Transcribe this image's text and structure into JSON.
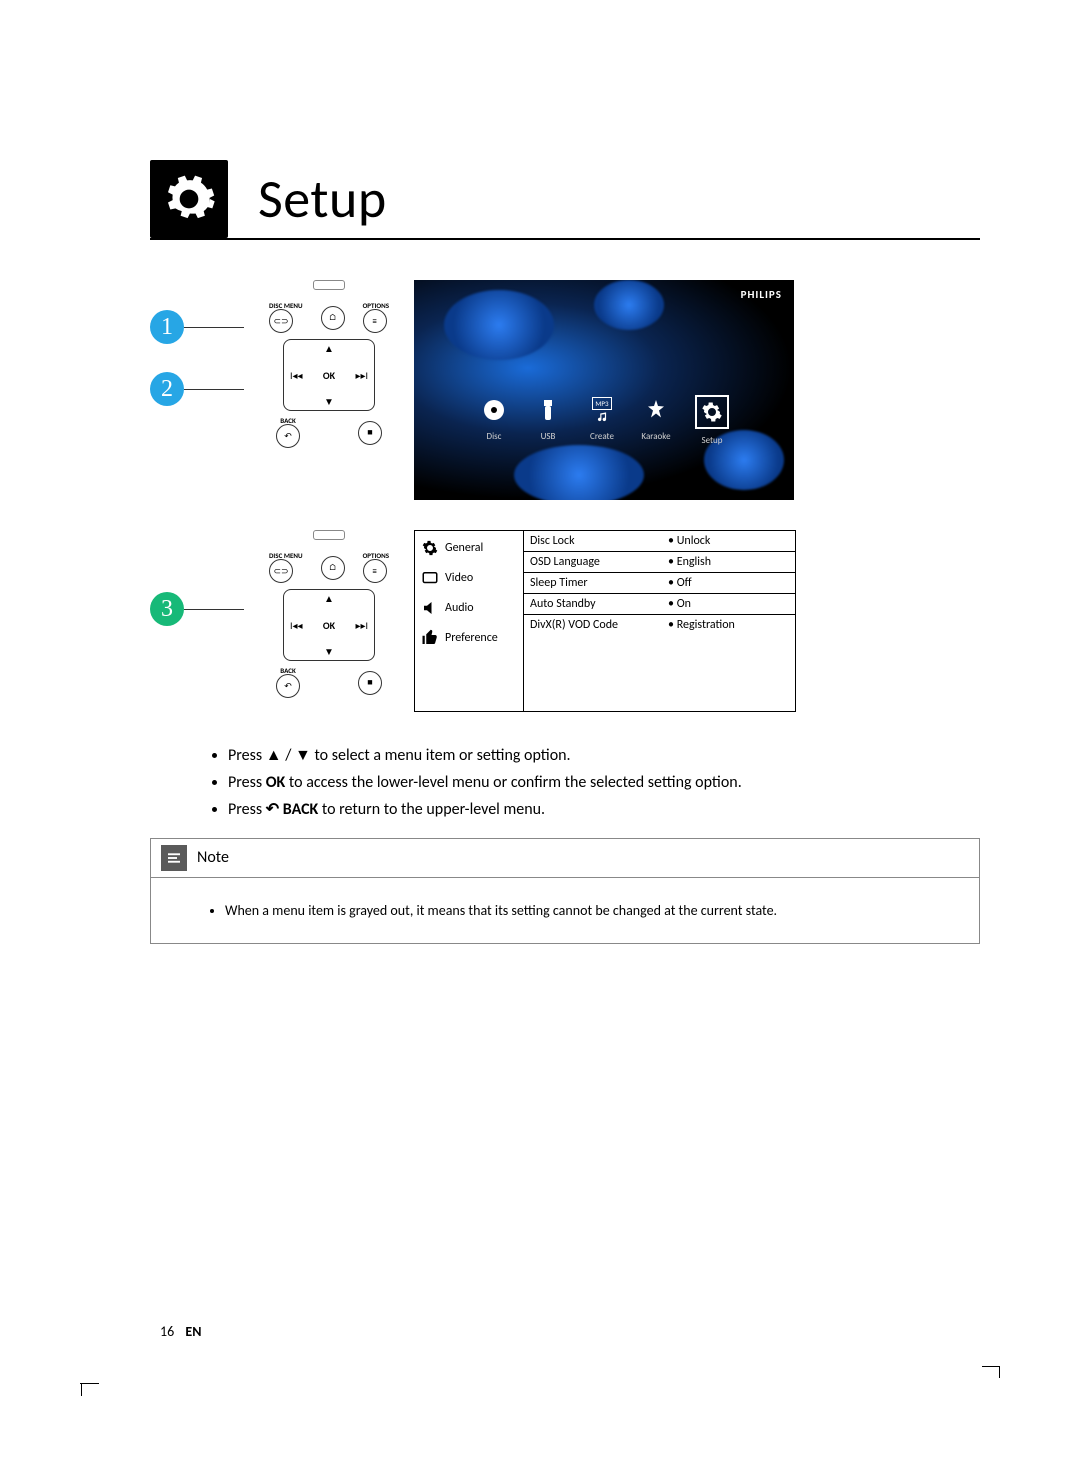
{
  "title": "Setup",
  "steps": {
    "s1": "1",
    "s2": "2",
    "s3": "3"
  },
  "remote": {
    "disc_menu": "DISC MENU",
    "options": "OPTIONS",
    "back": "BACK",
    "ok": "OK"
  },
  "screen": {
    "brand": "PHILIPS",
    "menu": [
      {
        "label": "Disc"
      },
      {
        "label": "USB"
      },
      {
        "label": "Create",
        "badge": "MP3"
      },
      {
        "label": "Karaoke"
      },
      {
        "label": "Setup",
        "selected": true
      }
    ]
  },
  "setup": {
    "categories": [
      "General",
      "Video",
      "Audio",
      "Preference"
    ],
    "options": [
      {
        "label": "Disc Lock",
        "value": "Unlock"
      },
      {
        "label": "OSD Language",
        "value": "English"
      },
      {
        "label": "Sleep Timer",
        "value": "Off"
      },
      {
        "label": "Auto Standby",
        "value": "On"
      },
      {
        "label": "DivX(R) VOD Code",
        "value": "Registration"
      }
    ]
  },
  "instructions": {
    "i1_a": "Press ",
    "i1_b": " / ",
    "i1_c": " to select a menu item or setting option.",
    "i2_a": "Press ",
    "i2_b": "OK",
    "i2_c": " to access the lower-level menu or confirm the selected setting option.",
    "i3_a": "Press ",
    "i3_b": " BACK",
    "i3_c": " to return to the upper-level menu."
  },
  "note": {
    "title": "Note",
    "body": "When a menu item is grayed out, it means that its setting cannot be changed at the current state."
  },
  "footer": {
    "page": "16",
    "lang": "EN"
  }
}
